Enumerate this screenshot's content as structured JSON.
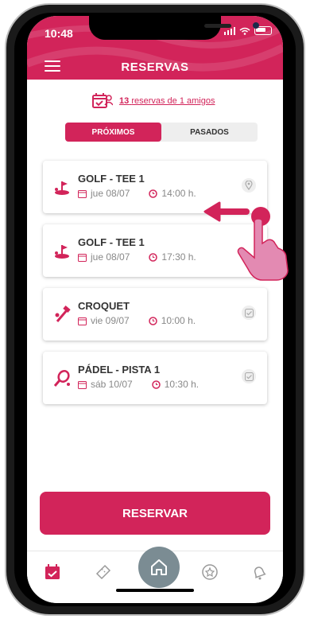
{
  "status": {
    "time": "10:48"
  },
  "header": {
    "title": "RESERVAS"
  },
  "friends": {
    "count": "13",
    "text": "reservas de 1 amigos"
  },
  "tabs": [
    {
      "label": "PRÓXIMOS",
      "active": true
    },
    {
      "label": "PASADOS",
      "active": false
    }
  ],
  "reservations": [
    {
      "title": "GOLF - TEE 1",
      "date": "jue 08/07",
      "time": "14:00 h.",
      "icon": "golf-icon",
      "action_icon": "location-pin-icon"
    },
    {
      "title": "GOLF - TEE 1",
      "date": "jue 08/07",
      "time": "17:30 h.",
      "icon": "golf-icon",
      "action_icon": ""
    },
    {
      "title": "CROQUET",
      "date": "vie 09/07",
      "time": "10:00 h.",
      "icon": "croquet-icon",
      "action_icon": "check-icon"
    },
    {
      "title": "PÁDEL - PISTA 1",
      "date": "sáb 10/07",
      "time": "10:30 h.",
      "icon": "padel-icon",
      "action_icon": "check-icon"
    }
  ],
  "reserve_button": {
    "label": "RESERVAR"
  },
  "bottom_nav": [
    {
      "name": "calendar-icon",
      "active": true
    },
    {
      "name": "ticket-icon",
      "active": false
    },
    {
      "name": "home-icon",
      "active": false
    },
    {
      "name": "star-badge-icon",
      "active": false
    },
    {
      "name": "bell-icon",
      "active": false
    }
  ],
  "colors": {
    "accent": "#d2245a",
    "muted": "#888888",
    "home": "#7b8c93"
  }
}
